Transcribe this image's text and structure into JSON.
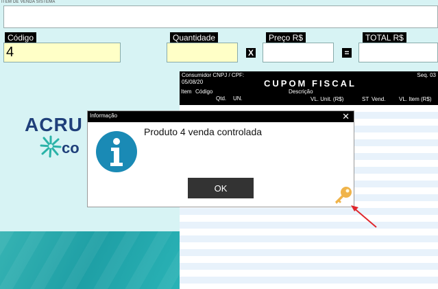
{
  "header": {
    "tiny_title": "ITEM DE VENDA SISTEMA",
    "description_value": ""
  },
  "fields": {
    "codigo": {
      "label": "Código",
      "value": "4"
    },
    "quantidade": {
      "label": "Quantidade",
      "value": ""
    },
    "preco": {
      "label": "Preço R$",
      "value": ""
    },
    "total": {
      "label": "TOTAL R$",
      "value": ""
    },
    "multiply_symbol": "X",
    "equals_symbol": "="
  },
  "logo": {
    "text": "ACRU",
    "sub": "co"
  },
  "receipt": {
    "consumidor": "Consumidor CNPJ / CPF:",
    "date": "05/08/20",
    "seq": "Seq. 03",
    "title": "CUPOM FISCAL",
    "columns": {
      "item": "Item",
      "codigo": "Código",
      "descricao": "Descrição",
      "qtd": "Qtd.",
      "un": "UN.",
      "vl_unit": "VL. Unit. (R$)",
      "st": "ST",
      "vend": "Vend.",
      "vl_item": "VL. Item (R$)"
    }
  },
  "dialog": {
    "title": "Informação",
    "close": "✕",
    "message": "Produto 4 venda controlada",
    "ok_label": "OK",
    "icon": "info-icon"
  },
  "annotations": {
    "key_icon": "key-icon",
    "arrow_color": "#e0262b"
  },
  "colors": {
    "input_highlight": "#ffffc7",
    "logo_blue": "#1f3f7a",
    "info_blue": "#1a8ab5",
    "key_gold": "#f0b44a"
  }
}
